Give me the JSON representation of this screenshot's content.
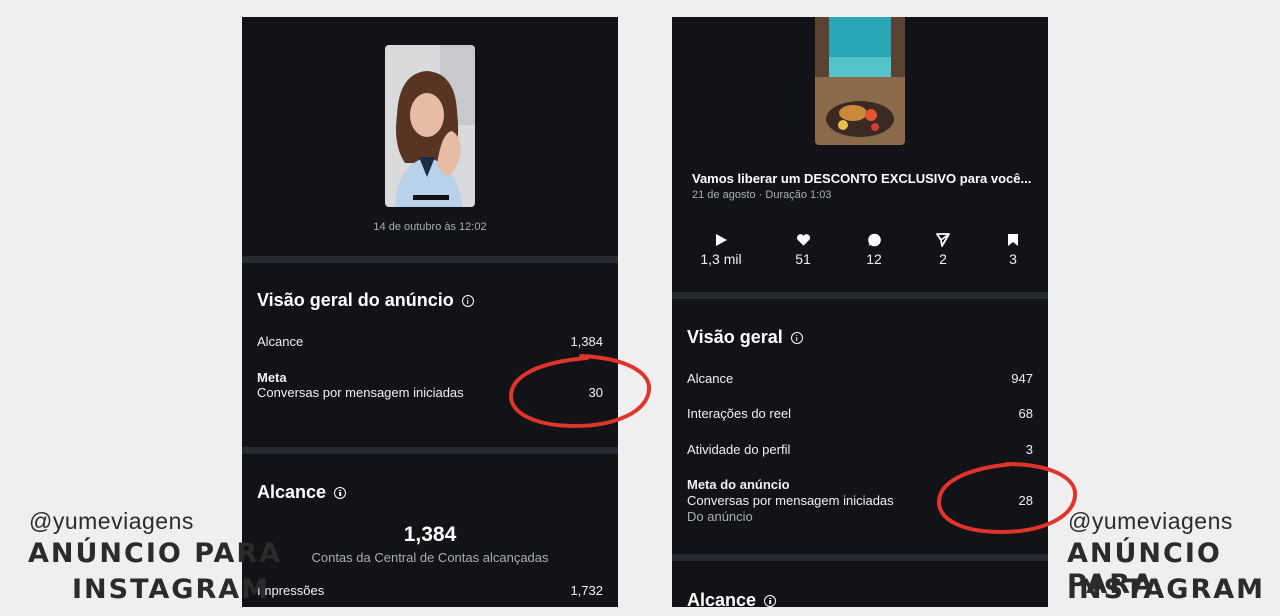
{
  "left": {
    "date_label": "14 de outubro às 12:02",
    "overview_title": "Visão geral do anúncio",
    "reach_label": "Alcance",
    "reach_value": "1,384",
    "goal_label": "Meta",
    "goal_sub_label": "Conversas por mensagem iniciadas",
    "goal_value": "30",
    "reach_section_title": "Alcance",
    "reach_big_value": "1,384",
    "reach_big_caption": "Contas da Central de Contas alcançadas",
    "impressions_label": "Impressões",
    "impressions_value": "1,732"
  },
  "right": {
    "post_title": "Vamos liberar um DESCONTO EXCLUSIVO para você...",
    "post_meta": "21 de agosto · Duração 1:03",
    "stats": {
      "plays": "1,3 mil",
      "likes": "51",
      "comments": "12",
      "shares": "2",
      "saves": "3"
    },
    "overview_title": "Visão geral",
    "reach_label": "Alcance",
    "reach_value": "947",
    "interactions_label": "Interações do reel",
    "interactions_value": "68",
    "profile_activity_label": "Atividade do perfil",
    "profile_activity_value": "3",
    "goal_label": "Meta do anúncio",
    "goal_sub_label": "Conversas por mensagem iniciadas",
    "goal_source": "Do anúncio",
    "goal_value": "28",
    "reach_section_title": "Alcance"
  },
  "branding": {
    "handle": "@yumeviagens",
    "line1": "ANÚNCIO PARA",
    "line2": "INSTAGRAM"
  },
  "colors": {
    "panel_bg": "#121317",
    "divider": "#262a31",
    "highlight_ring": "#e0342c",
    "page_bg": "#efefef"
  }
}
